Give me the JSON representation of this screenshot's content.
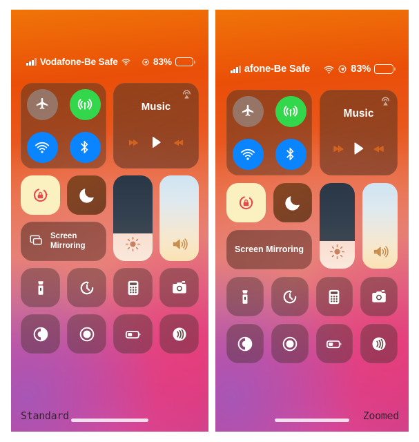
{
  "panels": [
    {
      "variant": "standard",
      "caption": "Standard",
      "status": {
        "signal_icon": "cellular-bars-icon",
        "carrier": "Vodafone-Be Safe",
        "wifi_icon": "wifi-icon",
        "location_icon": "location-services-icon",
        "battery_percent": "83%",
        "battery_icon": "battery-icon",
        "battery_level": 83
      },
      "connectivity": {
        "airplane": {
          "label": "Airplane Mode",
          "icon": "airplane-icon",
          "state": "off",
          "color": "#968479"
        },
        "cellular": {
          "label": "Cellular Data",
          "icon": "cellular-antenna-icon",
          "state": "on",
          "color": "#32d74b"
        },
        "wifi": {
          "label": "Wi-Fi",
          "icon": "wifi-icon",
          "state": "on",
          "color": "#0a84ff"
        },
        "bluetooth": {
          "label": "Bluetooth",
          "icon": "bluetooth-icon",
          "state": "on",
          "color": "#0a84ff"
        }
      },
      "music": {
        "title": "Music",
        "airplay_icon": "airplay-audio-icon",
        "rewind_icon": "rewind-icon",
        "play_icon": "play-icon",
        "forward_icon": "fast-forward-icon",
        "accent": "#d2631f"
      },
      "rotation_lock": {
        "label": "Rotation Lock",
        "icon": "rotation-lock-icon",
        "state": "on",
        "color": "#e8484f"
      },
      "do_not_disturb": {
        "label": "Do Not Disturb",
        "icon": "moon-icon",
        "state": "off"
      },
      "screen_mirroring": {
        "label": "Screen\nMirroring",
        "line1": "Screen",
        "line2": "Mirroring",
        "icon": "screen-mirroring-icon",
        "show_icon": true
      },
      "brightness": {
        "label": "Brightness",
        "icon": "brightness-icon",
        "value": 32
      },
      "volume": {
        "label": "Volume",
        "icon": "volume-icon",
        "value": 96
      },
      "apps": [
        {
          "label": "Flashlight",
          "icon": "flashlight-icon"
        },
        {
          "label": "Timer",
          "icon": "timer-icon"
        },
        {
          "label": "Calculator",
          "icon": "calculator-icon"
        },
        {
          "label": "Camera",
          "icon": "camera-icon"
        },
        {
          "label": "Dark Mode",
          "icon": "dark-mode-icon"
        },
        {
          "label": "Screen Recording",
          "icon": "screen-record-icon"
        },
        {
          "label": "Low Power Mode",
          "icon": "low-power-battery-icon"
        },
        {
          "label": "Apple Pay / NFC",
          "icon": "nfc-wave-icon"
        }
      ],
      "home_indicator": "home-indicator"
    },
    {
      "variant": "zoomed",
      "caption": "Zoomed",
      "status": {
        "signal_icon": "cellular-bars-icon",
        "carrier": "afone-Be Safe",
        "wifi_icon": "wifi-icon",
        "location_icon": "location-services-icon",
        "battery_percent": "83%",
        "battery_icon": "battery-icon",
        "battery_level": 83
      },
      "connectivity": {
        "airplane": {
          "label": "Airplane Mode",
          "icon": "airplane-icon",
          "state": "off",
          "color": "#968479"
        },
        "cellular": {
          "label": "Cellular Data",
          "icon": "cellular-antenna-icon",
          "state": "on",
          "color": "#32d74b"
        },
        "wifi": {
          "label": "Wi-Fi",
          "icon": "wifi-icon",
          "state": "on",
          "color": "#0a84ff"
        },
        "bluetooth": {
          "label": "Bluetooth",
          "icon": "bluetooth-icon",
          "state": "on",
          "color": "#0a84ff"
        }
      },
      "music": {
        "title": "Music",
        "airplay_icon": "airplay-audio-icon",
        "rewind_icon": "rewind-icon",
        "play_icon": "play-icon",
        "forward_icon": "fast-forward-icon",
        "accent": "#d2631f"
      },
      "rotation_lock": {
        "label": "Rotation Lock",
        "icon": "rotation-lock-icon",
        "state": "on",
        "color": "#e8484f"
      },
      "do_not_disturb": {
        "label": "Do Not Disturb",
        "icon": "moon-icon",
        "state": "off"
      },
      "screen_mirroring": {
        "label": "Screen Mirroring",
        "line1": "Screen Mirroring",
        "line2": "",
        "icon": "screen-mirroring-icon",
        "show_icon": false
      },
      "brightness": {
        "label": "Brightness",
        "icon": "brightness-icon",
        "value": 32
      },
      "volume": {
        "label": "Volume",
        "icon": "volume-icon",
        "value": 96
      },
      "apps": [
        {
          "label": "Flashlight",
          "icon": "flashlight-icon"
        },
        {
          "label": "Timer",
          "icon": "timer-icon"
        },
        {
          "label": "Calculator",
          "icon": "calculator-icon"
        },
        {
          "label": "Camera",
          "icon": "camera-icon"
        },
        {
          "label": "Dark Mode",
          "icon": "dark-mode-icon"
        },
        {
          "label": "Screen Recording",
          "icon": "screen-record-icon"
        },
        {
          "label": "Low Power Mode",
          "icon": "low-power-battery-icon"
        },
        {
          "label": "Apple Pay / NFC",
          "icon": "nfc-wave-icon"
        }
      ],
      "home_indicator": "home-indicator"
    }
  ]
}
